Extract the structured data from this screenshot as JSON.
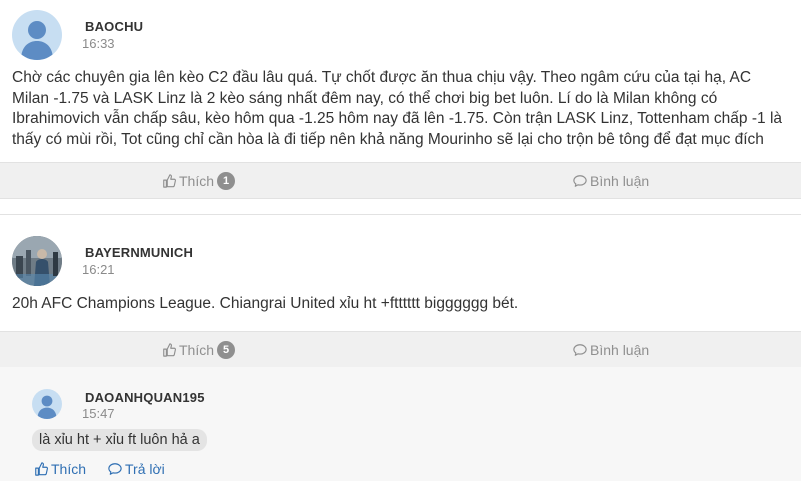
{
  "posts": [
    {
      "username": "BAOCHU",
      "time": "16:33",
      "body": "Chờ các chuyên gia lên kèo C2 đầu lâu quá. Tự chốt được ăn thua chịu vậy. Theo ngâm cứu của tại hạ, AC Milan -1.75 và LASK Linz là 2 kèo sáng nhất đêm nay, có thể chơi big bet luôn. Lí do là Milan không có Ibrahimovich vẫn chấp sâu, kèo hôm qua -1.25 hôm nay đã lên -1.75. Còn trận LASK Linz, Tottenham chấp -1 là thấy có mùi rồi, Tot cũng chỉ cần hòa là đi tiếp nên khả năng Mourinho sẽ lại cho trộn bê tông để đạt mục đích",
      "like_label": "Thích",
      "like_count": "1",
      "comment_label": "Bình luận"
    },
    {
      "username": "BAYERNMUNICH",
      "time": "16:21",
      "body": "20h AFC Champions League. Chiangrai United xỉu ht +ftttttt bigggggg bét.",
      "like_label": "Thích",
      "like_count": "5",
      "comment_label": "Bình luận"
    }
  ],
  "reply": {
    "username": "DAOANHQUAN195",
    "time": "15:47",
    "body": "là xỉu ht + xỉu ft luôn hả a",
    "like_label": "Thích",
    "reply_label": "Trả lời"
  },
  "icons": {
    "like": "thumbs-up-icon",
    "comment": "comment-bubble-icon"
  },
  "colors": {
    "link": "#2f6fb3",
    "muted": "#8f8f8f",
    "bar": "#f0f0f0"
  }
}
